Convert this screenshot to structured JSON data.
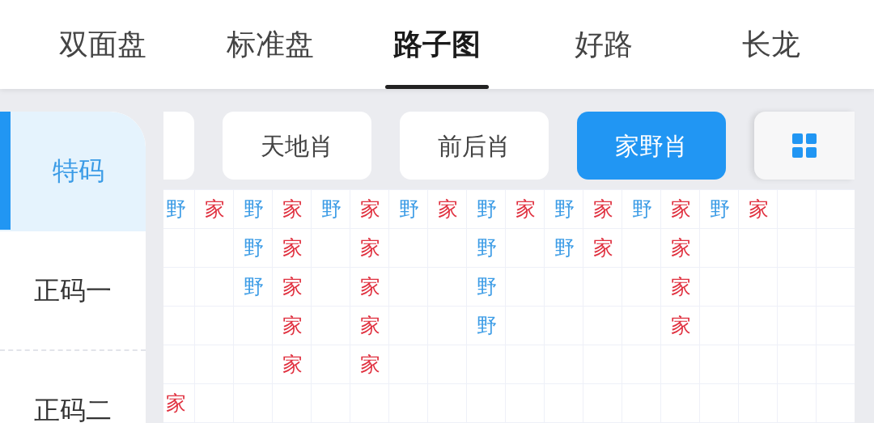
{
  "tabs": [
    {
      "label": "双面盘",
      "selected": false
    },
    {
      "label": "标准盘",
      "selected": false
    },
    {
      "label": "路子图",
      "selected": true
    },
    {
      "label": "好路",
      "selected": false
    },
    {
      "label": "长龙",
      "selected": false
    }
  ],
  "sidebar": {
    "items": [
      {
        "label": "特码",
        "selected": true
      },
      {
        "label": "正码一",
        "selected": false
      },
      {
        "label": "正码二",
        "selected": false
      }
    ]
  },
  "filters": [
    {
      "label": "天地肖",
      "selected": false
    },
    {
      "label": "前后肖",
      "selected": false
    },
    {
      "label": "家野肖",
      "selected": true
    }
  ],
  "grid": {
    "columns": [
      {
        "cells": [
          {
            "text": "野",
            "color": "#3c9ce6"
          },
          null,
          null,
          null,
          null,
          {
            "text": "家",
            "color": "#e0303f"
          }
        ]
      },
      {
        "cells": [
          {
            "text": "家",
            "color": "#e0303f"
          }
        ]
      },
      {
        "cells": [
          {
            "text": "野",
            "color": "#3c9ce6"
          },
          {
            "text": "野",
            "color": "#3c9ce6"
          },
          {
            "text": "野",
            "color": "#3c9ce6"
          }
        ]
      },
      {
        "cells": [
          {
            "text": "家",
            "color": "#e0303f"
          },
          {
            "text": "家",
            "color": "#e0303f"
          },
          {
            "text": "家",
            "color": "#e0303f"
          },
          {
            "text": "家",
            "color": "#e0303f"
          },
          {
            "text": "家",
            "color": "#e0303f"
          }
        ]
      },
      {
        "cells": [
          {
            "text": "野",
            "color": "#3c9ce6"
          }
        ]
      },
      {
        "cells": [
          {
            "text": "家",
            "color": "#e0303f"
          },
          {
            "text": "家",
            "color": "#e0303f"
          },
          {
            "text": "家",
            "color": "#e0303f"
          },
          {
            "text": "家",
            "color": "#e0303f"
          },
          {
            "text": "家",
            "color": "#e0303f"
          }
        ]
      },
      {
        "cells": [
          {
            "text": "野",
            "color": "#3c9ce6"
          }
        ]
      },
      {
        "cells": [
          {
            "text": "家",
            "color": "#e0303f"
          }
        ]
      },
      {
        "cells": [
          {
            "text": "野",
            "color": "#3c9ce6"
          },
          {
            "text": "野",
            "color": "#3c9ce6"
          },
          {
            "text": "野",
            "color": "#3c9ce6"
          },
          {
            "text": "野",
            "color": "#3c9ce6"
          }
        ]
      },
      {
        "cells": [
          {
            "text": "家",
            "color": "#e0303f"
          }
        ]
      },
      {
        "cells": [
          {
            "text": "野",
            "color": "#3c9ce6"
          },
          {
            "text": "野",
            "color": "#3c9ce6"
          }
        ]
      },
      {
        "cells": [
          {
            "text": "家",
            "color": "#e0303f"
          },
          {
            "text": "家",
            "color": "#e0303f"
          }
        ]
      },
      {
        "cells": [
          {
            "text": "野",
            "color": "#3c9ce6"
          }
        ]
      },
      {
        "cells": [
          {
            "text": "家",
            "color": "#e0303f"
          },
          {
            "text": "家",
            "color": "#e0303f"
          },
          {
            "text": "家",
            "color": "#e0303f"
          },
          {
            "text": "家",
            "color": "#e0303f"
          }
        ]
      },
      {
        "cells": [
          {
            "text": "野",
            "color": "#3c9ce6"
          }
        ]
      },
      {
        "cells": [
          {
            "text": "家",
            "color": "#e0303f"
          }
        ]
      }
    ]
  }
}
